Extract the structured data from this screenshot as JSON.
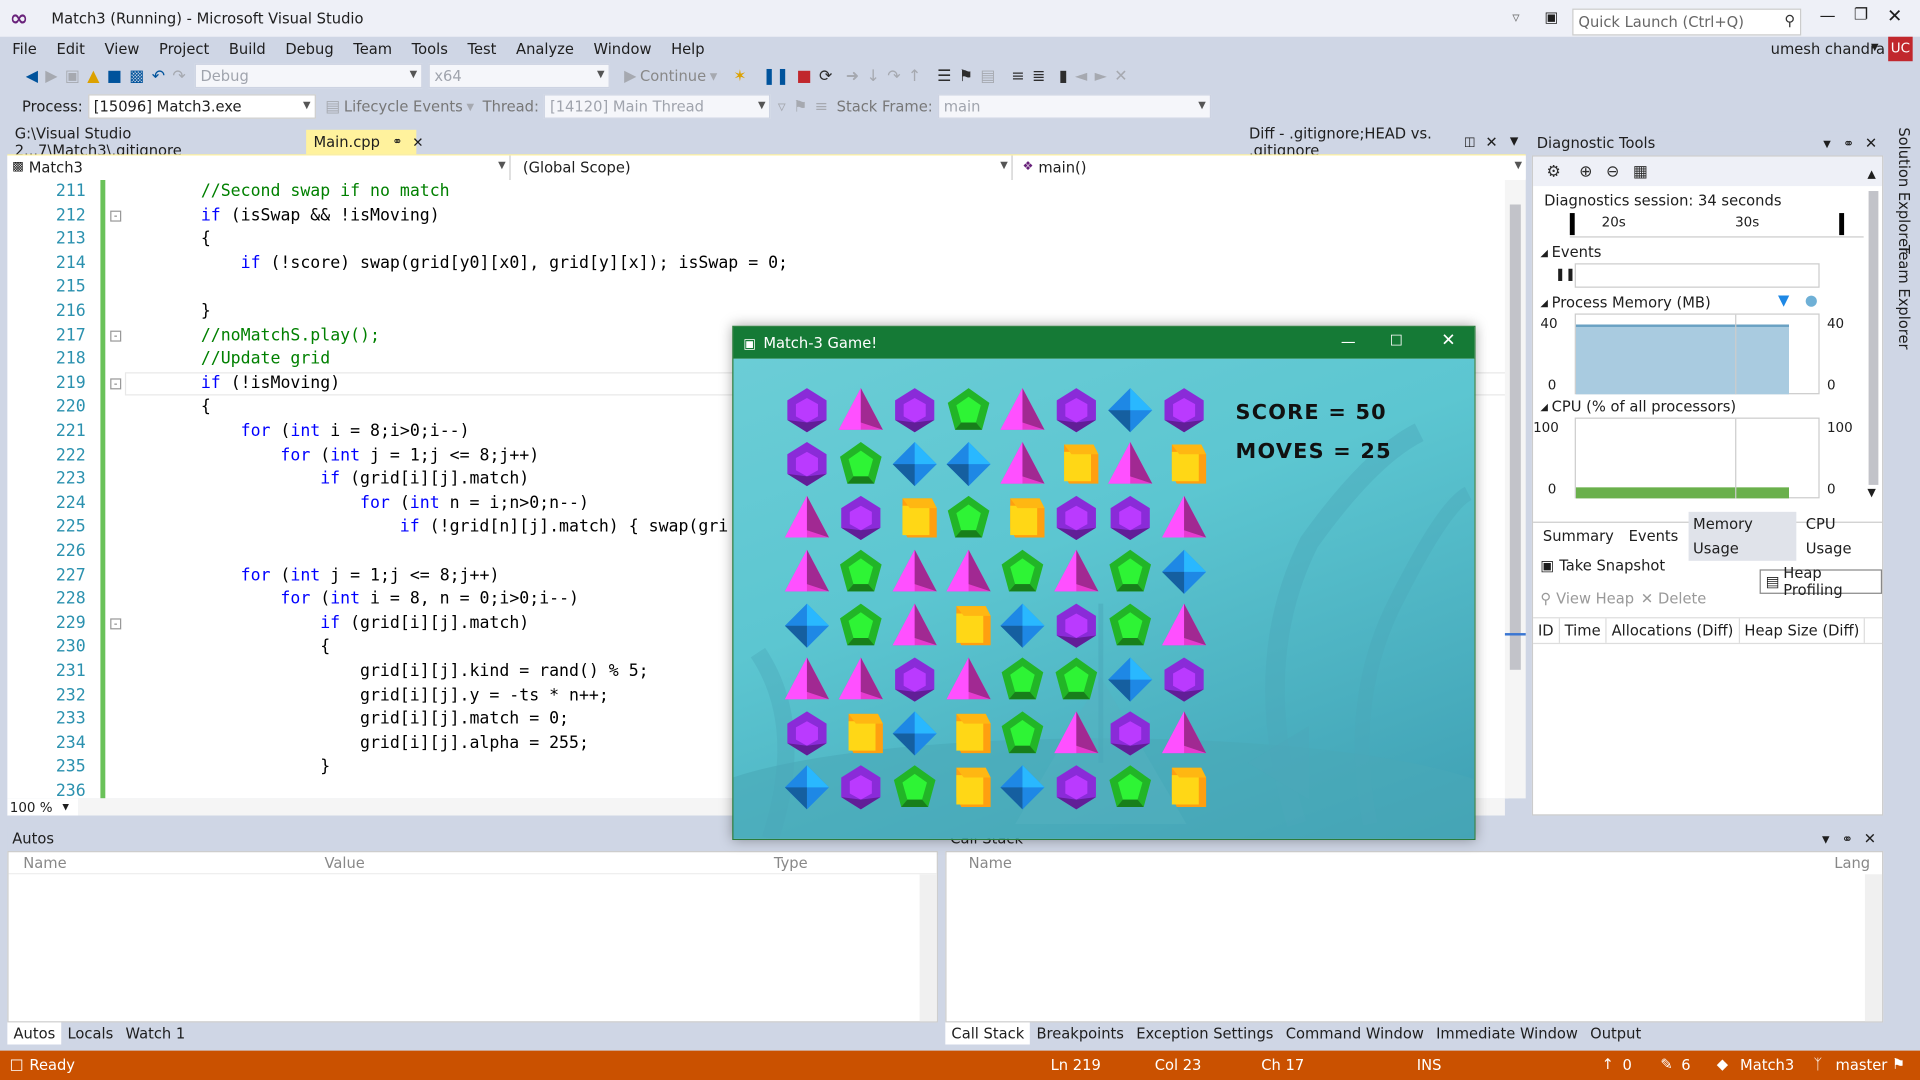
{
  "window": {
    "title": "Match3 (Running) - Microsoft Visual Studio",
    "quick_launch_placeholder": "Quick Launch (Ctrl+Q)",
    "user": "umesh chandra",
    "user_initials": "UC"
  },
  "menu": [
    "File",
    "Edit",
    "View",
    "Project",
    "Build",
    "Debug",
    "Team",
    "Tools",
    "Test",
    "Analyze",
    "Window",
    "Help"
  ],
  "toolbar": {
    "config": "Debug",
    "platform": "x64",
    "continue": "Continue"
  },
  "debug_bar": {
    "process_label": "Process:",
    "process": "[15096] Match3.exe",
    "lifecycle": "Lifecycle Events",
    "thread_label": "Thread:",
    "thread": "[14120] Main Thread",
    "stack_label": "Stack Frame:",
    "stack": "main"
  },
  "doc_tabs": {
    "left": "G:\\Visual Studio 2...7\\Match3\\.gitignore",
    "active": "Main.cpp",
    "right": "Diff - .gitignore;HEAD vs. .gitignore"
  },
  "nav": {
    "project": "Match3",
    "scope": "(Global Scope)",
    "member": "main()"
  },
  "zoom": "100 %",
  "code_lines": [
    {
      "n": "211",
      "t": "//Second swap if no match",
      "c": "cm",
      "i": 0
    },
    {
      "n": "212",
      "t": "if (isSwap && !isMoving)",
      "c": "",
      "i": 0
    },
    {
      "n": "213",
      "t": "{",
      "c": "",
      "i": 0
    },
    {
      "n": "214",
      "t": "if (!score) swap(grid[y0][x0], grid[y][x]); isSwap = 0;",
      "c": "",
      "i": 1
    },
    {
      "n": "215",
      "t": "",
      "c": "",
      "i": 0
    },
    {
      "n": "216",
      "t": "}",
      "c": "",
      "i": 0
    },
    {
      "n": "217",
      "t": "//noMatchS.play();",
      "c": "cm",
      "i": 0
    },
    {
      "n": "218",
      "t": "//Update grid",
      "c": "cm",
      "i": 0
    },
    {
      "n": "219",
      "t": "if (!isMoving)",
      "c": "",
      "i": 0
    },
    {
      "n": "220",
      "t": "{",
      "c": "",
      "i": 0
    },
    {
      "n": "221",
      "t": "for (int i = 8;i>0;i--)",
      "c": "",
      "i": 1
    },
    {
      "n": "222",
      "t": "for (int j = 1;j <= 8;j++)",
      "c": "",
      "i": 2
    },
    {
      "n": "223",
      "t": "if (grid[i][j].match)",
      "c": "",
      "i": 3
    },
    {
      "n": "224",
      "t": "for (int n = i;n>0;n--)",
      "c": "",
      "i": 4
    },
    {
      "n": "225",
      "t": "if (!grid[n][j].match) { swap(gri",
      "c": "",
      "i": 5
    },
    {
      "n": "226",
      "t": "",
      "c": "",
      "i": 0
    },
    {
      "n": "227",
      "t": "for (int j = 1;j <= 8;j++)",
      "c": "",
      "i": 1
    },
    {
      "n": "228",
      "t": "for (int i = 8, n = 0;i>0;i--)",
      "c": "",
      "i": 2
    },
    {
      "n": "229",
      "t": "if (grid[i][j].match)",
      "c": "",
      "i": 3
    },
    {
      "n": "230",
      "t": "{",
      "c": "",
      "i": 3
    },
    {
      "n": "231",
      "t": "grid[i][j].kind = rand() % 5;",
      "c": "",
      "i": 4
    },
    {
      "n": "232",
      "t": "grid[i][j].y = -ts * n++;",
      "c": "",
      "i": 4
    },
    {
      "n": "233",
      "t": "grid[i][j].match = 0;",
      "c": "",
      "i": 4
    },
    {
      "n": "234",
      "t": "grid[i][j].alpha = 255;",
      "c": "",
      "i": 4
    },
    {
      "n": "235",
      "t": "}",
      "c": "",
      "i": 3
    },
    {
      "n": "236",
      "t": "",
      "c": "",
      "i": 0
    }
  ],
  "diagnostics": {
    "title": "Diagnostic Tools",
    "session": "Diagnostics session: 34 seconds",
    "t1": "20s",
    "t2": "30s",
    "events": "Events",
    "memory": "Process Memory (MB)",
    "mem_max": "40",
    "mem_min": "0",
    "cpu": "CPU (% of all processors)",
    "cpu_max": "100",
    "cpu_min": "0",
    "tabs": [
      "Summary",
      "Events",
      "Memory Usage",
      "CPU Usage"
    ],
    "snapshot": "Take Snapshot",
    "heap_profiling": "Heap Profiling",
    "view_heap": "View Heap",
    "delete": "Delete",
    "cols": [
      "ID",
      "Time",
      "Allocations (Diff)",
      "Heap Size (Diff)"
    ]
  },
  "side_tabs": [
    "Solution Explorer",
    "Team Explorer"
  ],
  "autos": {
    "title": "Autos",
    "cols": [
      "Name",
      "Value",
      "Type"
    ],
    "tabs": [
      "Autos",
      "Locals",
      "Watch 1"
    ]
  },
  "callstack": {
    "title": "Call Stack",
    "cols": [
      "Name",
      "Lang"
    ],
    "tabs": [
      "Call Stack",
      "Breakpoints",
      "Exception Settings",
      "Command Window",
      "Immediate Window",
      "Output"
    ]
  },
  "status": {
    "ready": "Ready",
    "ln": "Ln 219",
    "col": "Col 23",
    "ch": "Ch 17",
    "ins": "INS",
    "up": "0",
    "pencil": "6",
    "repo": "Match3",
    "branch": "master"
  },
  "game": {
    "title": "Match-3 Game!",
    "score": "SCORE = 50",
    "moves": "MOVES = 25",
    "grid": [
      [
        "purple",
        "pink",
        "purple",
        "green",
        "pink",
        "purple",
        "blue",
        "purple"
      ],
      [
        "purple",
        "green",
        "blue",
        "blue",
        "pink",
        "orange",
        "pink",
        "orange"
      ],
      [
        "pink",
        "purple",
        "orange",
        "green",
        "orange",
        "purple",
        "purple",
        "pink"
      ],
      [
        "pink",
        "green",
        "pink",
        "pink",
        "green",
        "pink",
        "green",
        "blue"
      ],
      [
        "blue",
        "green",
        "pink",
        "orange",
        "blue",
        "purple",
        "green",
        "pink"
      ],
      [
        "pink",
        "pink",
        "purple",
        "pink",
        "green",
        "green",
        "blue",
        "purple"
      ],
      [
        "purple",
        "orange",
        "blue",
        "orange",
        "green",
        "pink",
        "purple",
        "pink"
      ],
      [
        "blue",
        "purple",
        "green",
        "orange",
        "blue",
        "purple",
        "green",
        "orange"
      ]
    ],
    "colors": {
      "purple": "#8a2bd8",
      "pink": "#e63bd0",
      "green": "#22b527",
      "blue": "#1e88e5",
      "orange": "#ff9f10"
    }
  }
}
